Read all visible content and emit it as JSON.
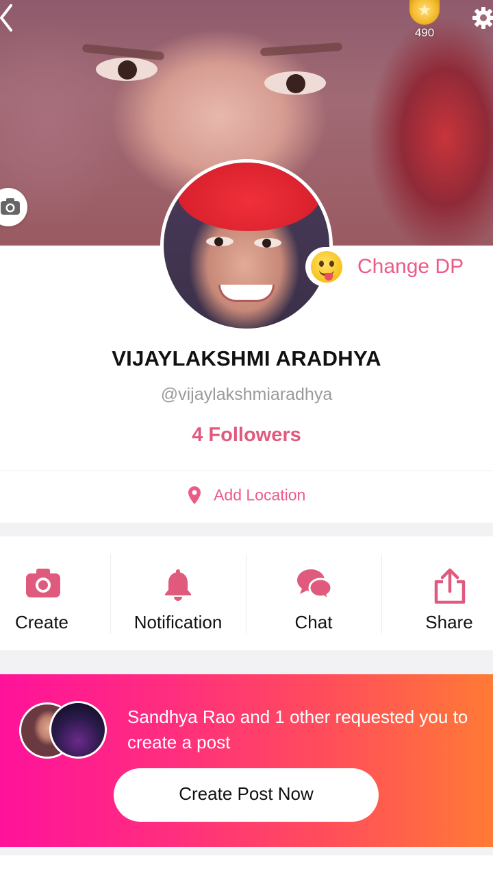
{
  "header": {
    "coin_count": "490",
    "icons": {
      "back": "back-chevron-icon",
      "settings": "gear-icon",
      "cover_camera": "camera-icon",
      "coin": "coin-icon"
    }
  },
  "profile": {
    "change_dp_label": "Change DP",
    "emoji": "tongue-emoji-icon",
    "name": "VIJAYLAKSHMI ARADHYA",
    "handle": "@vijaylakshmiaradhya",
    "followers": "4 Followers",
    "location_label": "Add Location"
  },
  "actions": [
    {
      "label": "Create",
      "icon": "camera-icon"
    },
    {
      "label": "Notification",
      "icon": "bell-icon"
    },
    {
      "label": "Chat",
      "icon": "chat-bubbles-icon"
    },
    {
      "label": "Share",
      "icon": "share-icon"
    }
  ],
  "promo": {
    "request_text": "Sandhya Rao and 1 other requested you to create a post",
    "cta_label": "Create Post Now"
  },
  "colors": {
    "accent": "#ec5a86",
    "gradient_start": "#ff129a",
    "gradient_end": "#ff7a35"
  }
}
